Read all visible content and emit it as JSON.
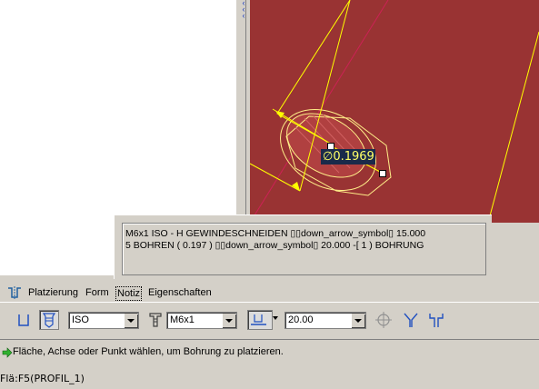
{
  "viewport": {
    "dimension_value": "0.1969",
    "dimension_prefix_symbol": "diameter-icon"
  },
  "note": {
    "line1": "M6x1 ISO - H GEWINDESCHNEIDEN ▯▯down_arrow_symbol▯ 15.000",
    "line2": "5 BOHREN ( 0.197 ) ▯▯down_arrow_symbol▯ 20.000  -[ 1 ) BOHRUNG"
  },
  "tabs": [
    {
      "label": "Platzierung",
      "active": false
    },
    {
      "label": "Form",
      "active": false
    },
    {
      "label": "Notiz",
      "active": true
    },
    {
      "label": "Eigenschaften",
      "active": false
    }
  ],
  "toolbar": {
    "standard_combo": "ISO",
    "thread_combo": "M6x1",
    "depth_combo": "20.00"
  },
  "status": {
    "message": "Fläche, Achse oder Punkt wählen, um Bohrung zu platzieren."
  },
  "footer": {
    "text": "Flä:F5(PROFIL_1)"
  },
  "colors": {
    "viewport_bg": "#993333",
    "sketch_yellow": "#ffff00",
    "dim_bg": "#1a2a4a",
    "dim_text": "#ffff66",
    "axis_line": "#cc2255"
  }
}
